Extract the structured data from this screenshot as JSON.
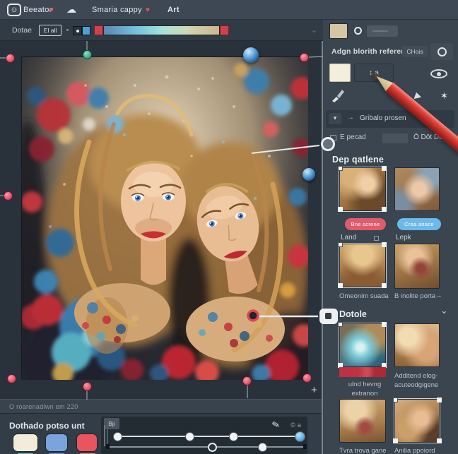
{
  "topbar": {
    "app_name": "Beeator",
    "doc_name": "Smaria cappy",
    "menu_art": "Art"
  },
  "toolbar2": {
    "label": "Dotae",
    "value_box": "El all"
  },
  "right_panel": {
    "ref_label": "Adgn blorith reference",
    "ref_button": "CHois",
    "stepper_value": "↕ a",
    "section_toggle": "Gribalo prosen",
    "action_left": "E pecad",
    "action_right": "Ô Döt Del",
    "group1": {
      "title": "Dep qatlene",
      "pill_red": "Bne screne",
      "pill_blue": "Crea anace",
      "items": [
        {
          "label": "Land"
        },
        {
          "label": "Lepk"
        },
        {
          "label": "Omeonim suada"
        },
        {
          "label": "B inolite porta –"
        }
      ]
    },
    "group2": {
      "title": "Dotole",
      "items": [
        {
          "label": "ulnd hevng extranon"
        },
        {
          "label": "Additend elog- acuteodgigene"
        },
        {
          "label": "Tvra trova gane"
        },
        {
          "label": "Anilia ppoiord"
        }
      ]
    }
  },
  "status_bar": {
    "text": "O roarenadlwn em 220"
  },
  "bottom_bar": {
    "title": "Dothado potso unt",
    "badge": "Bji",
    "meta": "© a"
  },
  "icons": {
    "smiley": "☺",
    "heart": "♥",
    "cloud": "☁",
    "chevron": "⌄",
    "caret": "▾",
    "arrow": "→",
    "star": "✶",
    "feather": "✎",
    "plus": "+"
  },
  "colors": {
    "accent_red": "#e25a6e",
    "accent_blue": "#6db9ea",
    "swatch_cream": "#f2ecd8",
    "swatch_blue": "#7aa5dc",
    "swatch_red": "#e85560",
    "handle_pink": "#e4647a",
    "handle_teal": "#4fb89e"
  }
}
